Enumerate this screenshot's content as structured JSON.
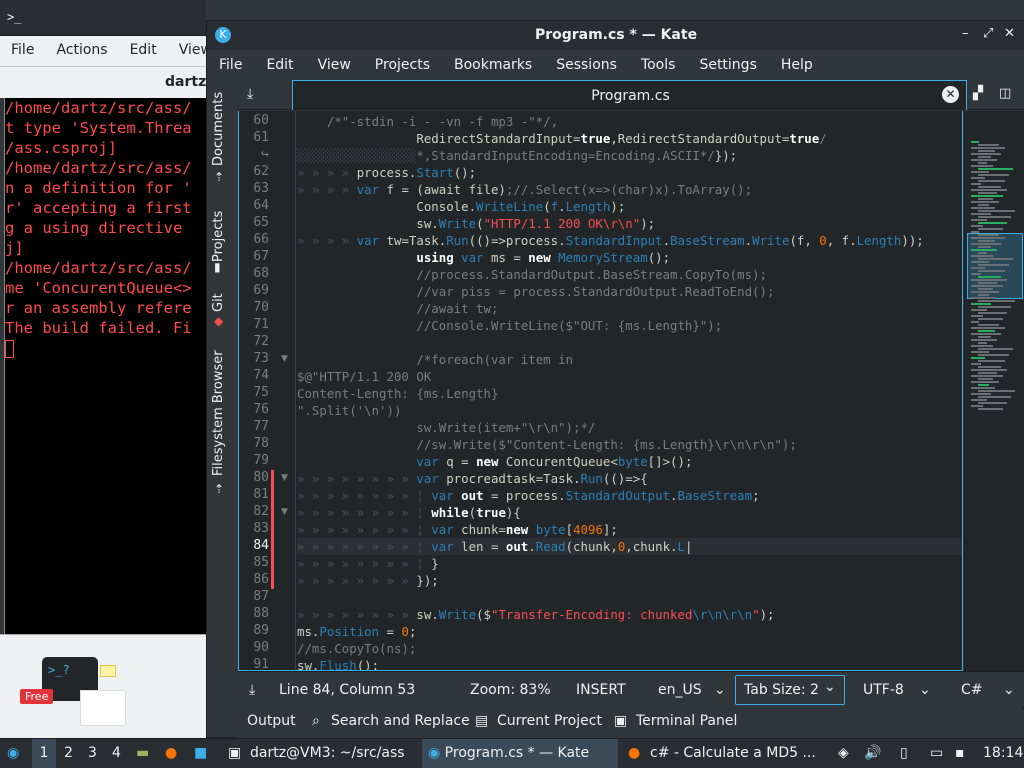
{
  "background_terminal": {
    "title_icon": ">_",
    "menu": [
      "File",
      "Actions",
      "Edit",
      "View"
    ],
    "tab_title": "dartz",
    "lines": [
      "/home/dartz/src/ass/",
      "t type 'System.Threa",
      "/ass.csproj]",
      "/home/dartz/src/ass/",
      "n a definition for '",
      "r' accepting a first",
      "g a using directive",
      "j]",
      "/home/dartz/src/ass/",
      "me 'ConcurentQueue<>",
      "r an assembly refere",
      "",
      "The build failed. Fi"
    ],
    "ad_badge": "Free",
    "ad_prompt": ">_?"
  },
  "kate": {
    "title": "Program.cs * — Kate",
    "menu": [
      "File",
      "Edit",
      "View",
      "Projects",
      "Bookmarks",
      "Sessions",
      "Tools",
      "Settings",
      "Help"
    ],
    "side_tabs": [
      "Documents",
      "Projects",
      "Git",
      "Filesystem Browser"
    ],
    "tab_label": "Program.cs",
    "lines": [
      {
        "n": "60",
        "html": "    <span class='cm'>/*\"-stdin -i - -vn -f mp3 -\"*/,</span>"
      },
      {
        "n": "61",
        "html": "                <span>RedirectStandardInput</span>=<span class='kw'>true</span>,<span>RedirectStandardOutput</span>=<span class='kw'>true</span><span class='cm'>/</span>"
      },
      {
        "n": "↪",
        "html": "<span class='ws'>░░░░░░░░░░░░░░░░</span><span class='cm'>*,StandardInputEncoding=Encoding.ASCII*/</span>});"
      },
      {
        "n": "62",
        "html": "<span class='ws'>» » » » </span>process.<span class='ty'>Start</span>();"
      },
      {
        "n": "63",
        "html": "<span class='ws'>» » » » </span><span class='ty'>var</span> f = (await file)<span class='cm'>;//.Select(x=>(char)x).ToArray();</span>"
      },
      {
        "n": "64",
        "html": "                Console.<span class='ty'>WriteLine</span>(<span class='ty'>f</span>.<span class='ty'>Length</span>);"
      },
      {
        "n": "65",
        "html": "                sw.<span class='ty'>Write</span>(<span class='st'>\"HTTP/1.1 200 OK\\r\\n\"</span>);"
      },
      {
        "n": "66",
        "html": "<span class='ws'>» » » » </span><span class='ty'>var</span> tw=Task.<span class='ty'>Run</span>(()=>process.<span class='ty'>StandardInput</span>.<span class='ty'>BaseStream</span>.<span class='ty'>Write</span>(f, <span class='nm'>0</span>, f.<span class='ty'>Length</span>));"
      },
      {
        "n": "67",
        "html": "                <span class='kw'>using</span> <span class='ty'>var</span> ms = <span class='kw'>new</span> <span class='ty'>MemoryStream</span>();"
      },
      {
        "n": "68",
        "html": "                <span class='cm'>//process.StandardOutput.BaseStream.CopyTo(ms);</span>"
      },
      {
        "n": "69",
        "html": "                <span class='cm'>//var piss = process.StandardOutput.ReadToEnd();</span>"
      },
      {
        "n": "70",
        "html": "                <span class='cm'>//await tw;</span>"
      },
      {
        "n": "71",
        "html": "                <span class='cm'>//Console.WriteLine($\"OUT: {ms.Length}\");</span>"
      },
      {
        "n": "72",
        "html": ""
      },
      {
        "n": "73",
        "html": "                <span class='cm'>/*foreach(var item in</span>"
      },
      {
        "n": "74",
        "html": "<span class='cm'>$@\"HTTP/1.1 200 OK</span>"
      },
      {
        "n": "75",
        "html": "<span class='cm'>Content-Length: {ms.Length}</span>"
      },
      {
        "n": "76",
        "html": "<span class='cm'>\".Split('\\n'))</span>"
      },
      {
        "n": "77",
        "html": "                <span class='cm'>sw.Write(item+\"\\r\\n\");*/</span>"
      },
      {
        "n": "78",
        "html": "                <span class='cm'>//sw.Write($\"Content-Length: {ms.Length}\\r\\n\\r\\n\");</span>"
      },
      {
        "n": "79",
        "html": "                <span class='ty'>var</span> q = <span class='kw'>new</span> ConcurentQueue&lt;<span class='ty'>byte</span>[]&gt;();"
      },
      {
        "n": "80",
        "html": "<span class='ws'>» » » » » » » » </span><span class='ty'>var</span> procreadtask=Task.<span class='ty'>Run</span>(()=>{"
      },
      {
        "n": "81",
        "html": "<span class='ws'>» » » » » » » » ¦ </span><span class='ty'>var</span> <span class='kw'>out</span> = process.<span class='ty'>StandardOutput</span>.<span class='ty'>BaseStream</span>;"
      },
      {
        "n": "82",
        "html": "<span class='ws'>» » » » » » » » ¦ </span><span class='kw'>while</span>(<span class='kw'>true</span>){"
      },
      {
        "n": "83",
        "html": "<span class='ws'>» » » » » » » » ¦ </span><span class='ty'>var</span> chunk=<span class='kw'>new</span> <span class='ty'>byte</span>[<span class='nm'>4096</span>];"
      },
      {
        "n": "84",
        "html": "<span class='ws'>» » » » » » » » ¦ </span><span class='ty'>var</span> len = <span class='kw'>out</span>.<span class='ty'>Read</span>(chunk,<span class='nm'>0</span>,chunk.<span class='ty'>L</span>|"
      },
      {
        "n": "85",
        "html": "<span class='ws'>» » » » » » » » ¦ </span>}"
      },
      {
        "n": "86",
        "html": "<span class='ws'>» » » » » » » » </span>});"
      },
      {
        "n": "87",
        "html": ""
      },
      {
        "n": "88",
        "html": "<span class='ws'>» » » » » » » » </span>sw.<span class='ty'>Write</span>($<span class='st'>\"Transfer-Encoding: chunked</span><span class='ty'>\\r\\n\\r\\n</span><span class='st'>\"</span>);"
      },
      {
        "n": "89",
        "html": "ms.<span class='ty'>Position</span> = <span class='nm'>0</span>;"
      },
      {
        "n": "90",
        "html": "<span class='cm'>//ms.CopyTo(ns);</span>"
      },
      {
        "n": "91",
        "html": "sw.<span class='ty'>Flush</span>();"
      }
    ],
    "status": {
      "position": "Line 84, Column 53",
      "zoom": "Zoom: 83%",
      "mode": "INSERT",
      "dictionary": "en_US",
      "tab_size": "Tab Size: 2",
      "encoding": "UTF-8",
      "language": "C#"
    },
    "toolviews": [
      "Output",
      "Search and Replace",
      "Current Project",
      "Terminal Panel"
    ]
  },
  "taskbar": {
    "desktops": [
      "1",
      "2",
      "3",
      "4"
    ],
    "tasks": [
      "dartz@VM3: ~/src/ass",
      "Program.cs * — Kate",
      "c# - Calculate a MD5 ..."
    ],
    "clock": "18:14"
  }
}
